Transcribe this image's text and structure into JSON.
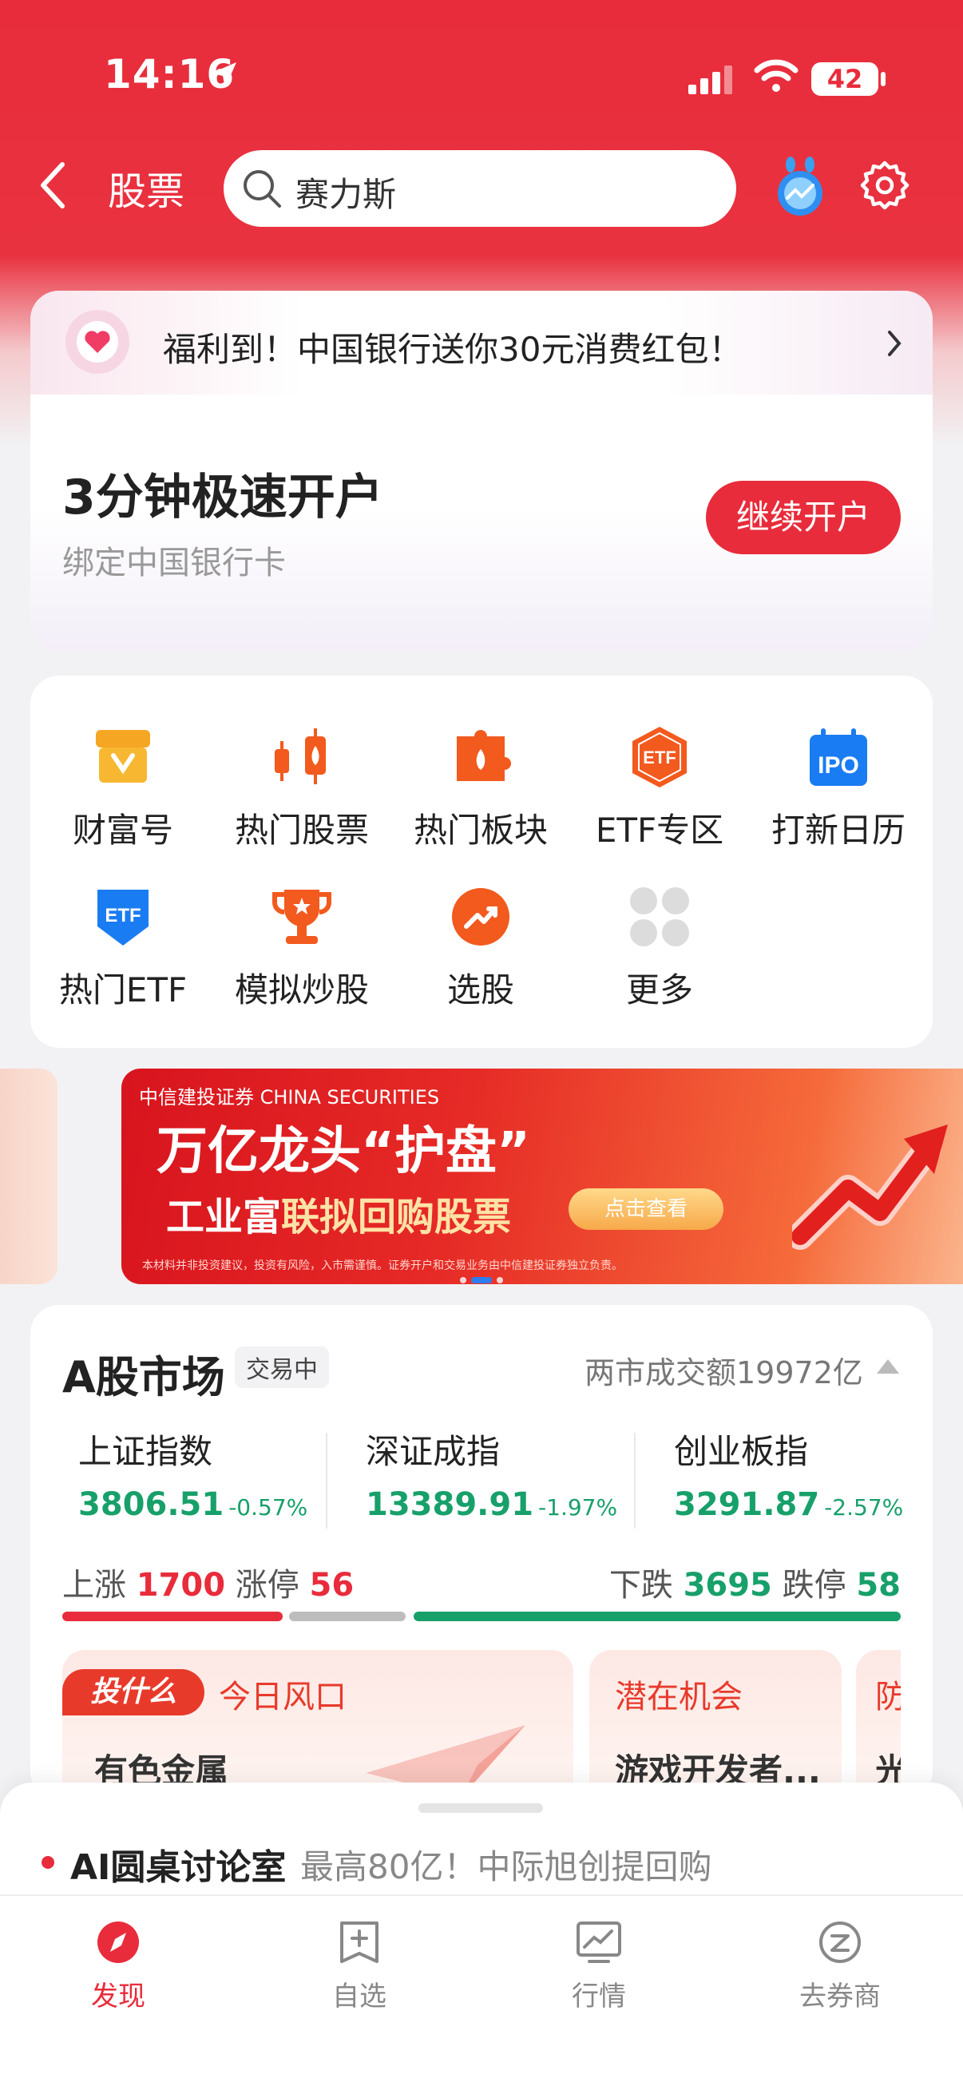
{
  "status_bar": {
    "time": "14:16",
    "battery": "42"
  },
  "header": {
    "title": "股票",
    "search_value": "赛力斯"
  },
  "promo": {
    "banner_text": "福利到！中国银行送你30元消费红包！",
    "title": "3分钟极速开户",
    "subtitle": "绑定中国银行卡",
    "button": "继续开户"
  },
  "shortcuts": [
    {
      "label": "财富号",
      "icon": "wealth-store-icon"
    },
    {
      "label": "热门股票",
      "icon": "hot-stock-candlestick-icon"
    },
    {
      "label": "热门板块",
      "icon": "hot-sector-puzzle-icon"
    },
    {
      "label": "ETF专区",
      "icon": "etf-zone-icon"
    },
    {
      "label": "打新日历",
      "icon": "ipo-calendar-icon"
    },
    {
      "label": "热门ETF",
      "icon": "hot-etf-shield-icon"
    },
    {
      "label": "模拟炒股",
      "icon": "trophy-icon"
    },
    {
      "label": "选股",
      "icon": "stock-picker-icon"
    },
    {
      "label": "更多",
      "icon": "more-grid-icon"
    }
  ],
  "ad_banner": {
    "logo": "中信建投证券 CHINA SECURITIES",
    "title": "万亿龙头“护盘”",
    "subtitle_a": "工业富",
    "subtitle_b": "联拟回购股票",
    "button": "点击查看",
    "fine_print": "本材料并非投资建议，投资有风险，入市需谨慎。证券开户和交易业务由中信建投证券独立负责。"
  },
  "market": {
    "title": "A股市场",
    "status": "交易中",
    "turnover": "两市成交额19972亿",
    "indices": [
      {
        "name": "上证指数",
        "value": "3806.51",
        "change": "-0.57%"
      },
      {
        "name": "深证成指",
        "value": "13389.91",
        "change": "-1.97%"
      },
      {
        "name": "创业板指",
        "value": "3291.87",
        "change": "-2.57%"
      }
    ],
    "breadth": {
      "up_label": "上涨",
      "up": "1700",
      "limit_up_label": "涨停",
      "limit_up": "56",
      "down_label": "下跌",
      "down": "3695",
      "limit_down_label": "跌停",
      "limit_down": "58"
    },
    "cards": [
      {
        "tag": "投什么",
        "title": "今日风口",
        "item": "有色金属"
      },
      {
        "title": "潜在机会",
        "item": "游戏开发者..."
      },
      {
        "title": "防",
        "item": "光"
      }
    ]
  },
  "sheet": {
    "title": "AI圆桌讨论室",
    "subtitle": "最高80亿！中际旭创提回购"
  },
  "tabs": [
    {
      "label": "发现",
      "icon": "compass-icon",
      "active": true
    },
    {
      "label": "自选",
      "icon": "watchlist-add-icon"
    },
    {
      "label": "行情",
      "icon": "market-chart-icon"
    },
    {
      "label": "去券商",
      "icon": "broker-icon"
    }
  ],
  "colors": {
    "brand_red": "#e82c3b",
    "down_green": "#17a06a",
    "accent_orange": "#f25a1e"
  }
}
